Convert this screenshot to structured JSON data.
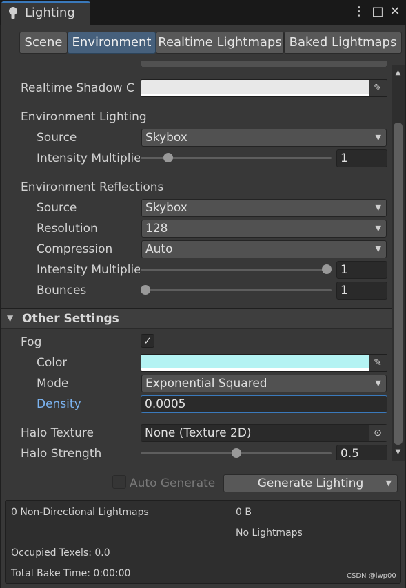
{
  "window": {
    "title": "Lighting",
    "menu_glyph": "⋮",
    "maximize_glyph": "□",
    "close_glyph": "✕"
  },
  "tabs": [
    {
      "label": "Scene",
      "active": false
    },
    {
      "label": "Environment",
      "active": true
    },
    {
      "label": "Realtime Lightmaps",
      "active": false
    },
    {
      "label": "Baked Lightmaps",
      "active": false
    }
  ],
  "realtime_shadow": {
    "label": "Realtime Shadow C",
    "color": "#e8e8e8"
  },
  "environment_lighting": {
    "header": "Environment Lighting",
    "source_label": "Source",
    "source_value": "Skybox",
    "intensity_label": "Intensity Multiplie",
    "intensity_value": "1",
    "intensity_fraction": 0.125
  },
  "environment_reflections": {
    "header": "Environment Reflections",
    "source_label": "Source",
    "source_value": "Skybox",
    "resolution_label": "Resolution",
    "resolution_value": "128",
    "compression_label": "Compression",
    "compression_value": "Auto",
    "intensity_label": "Intensity Multiplie",
    "intensity_value": "1",
    "intensity_fraction": 1.0,
    "bounces_label": "Bounces",
    "bounces_value": "1",
    "bounces_fraction": 0.0
  },
  "other_settings": {
    "header": "Other Settings",
    "fog_label": "Fog",
    "fog_checked": "✓",
    "color_label": "Color",
    "fog_color": "#b4f3f3",
    "mode_label": "Mode",
    "mode_value": "Exponential Squared",
    "density_label": "Density",
    "density_value": "0.0005",
    "halo_texture_label": "Halo Texture",
    "halo_texture_value": "None (Texture 2D)",
    "halo_strength_label": "Halo Strength",
    "halo_strength_value": "0.5",
    "halo_strength_fraction": 0.5
  },
  "footer": {
    "auto_generate_label": "Auto Generate",
    "generate_label": "Generate Lighting"
  },
  "stats": {
    "lightmaps": "0 Non-Directional Lightmaps",
    "size": "0 B",
    "no_lightmaps": "No Lightmaps",
    "occupied": "Occupied Texels: 0.0",
    "bake_time": "Total Bake Time: 0:00:00"
  },
  "watermark": "CSDN @lwp00",
  "colors": {
    "accent": "#3a79bb",
    "density_label": "#7bb3f0"
  }
}
